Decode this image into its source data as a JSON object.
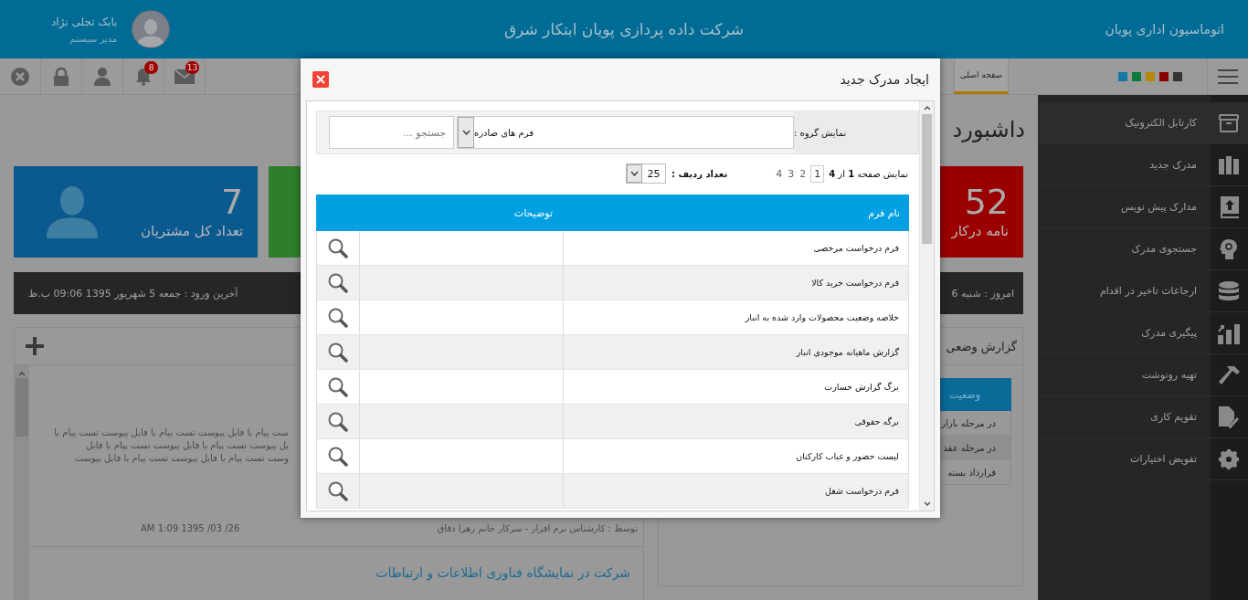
{
  "header": {
    "app_name": "اتوماسیون اداری پویان",
    "company": "شرکت داده پردازی پویان ابتکار شرق",
    "user": {
      "name": "بابک تجلی نژاد",
      "role": "مدیر سیستم"
    }
  },
  "toolbar": {
    "icons": [
      {
        "kind": "mail",
        "badge": "13"
      },
      {
        "kind": "bell",
        "badge": "8"
      },
      {
        "kind": "user"
      },
      {
        "kind": "lock"
      },
      {
        "kind": "close"
      }
    ],
    "tabs": [
      {
        "label": "صفحه اصلی",
        "selected": true
      }
    ],
    "swatches": [
      {
        "color": "#1379a5"
      },
      {
        "color": "#0d7a3d"
      },
      {
        "color": "#b58a0a"
      },
      {
        "color": "#8b0000"
      },
      {
        "color": "#333333"
      }
    ]
  },
  "sidebar": {
    "items": [
      {
        "label": "کارتابل الکترونیک",
        "kind": "archive",
        "selected": true
      },
      {
        "label": "مدرک جدید",
        "kind": "books",
        "selected": false
      },
      {
        "label": "مدارک پیش نویس",
        "kind": "upload-book",
        "selected": false
      },
      {
        "label": "جستجوی مدرک",
        "kind": "head",
        "selected": false
      },
      {
        "label": "ارجاعات تاخیر در اقدام",
        "kind": "database",
        "selected": false
      },
      {
        "label": "پیگیری مدرک",
        "kind": "chart",
        "selected": false
      },
      {
        "label": "تهیه رونوشت",
        "kind": "hammer",
        "selected": false
      },
      {
        "label": "تقویم کاری",
        "kind": "document",
        "selected": false
      },
      {
        "label": "تفویض اختیارات",
        "kind": "gear",
        "selected": false
      }
    ]
  },
  "dashboard": {
    "title": "داشبورد",
    "cards": [
      {
        "kind": "plain",
        "value": "52",
        "label": "نامه درکار",
        "color": "#9a0000"
      },
      {
        "kind": "plain",
        "color": "#2f7f2a"
      },
      {
        "kind": "person",
        "value": "7",
        "label": "تعداد کل مشتریان",
        "color": "#0a5a8f"
      }
    ],
    "last_login": "آخرین ورود : جمعه 5 شهریور 1395 09:06 ب.ظ",
    "today": "امروز : شنبه 6"
  },
  "messages": {
    "lines": [
      "ست پیام با فایل پیوست تست پیام با فایل پیوست تست پیام با",
      "یل پیوست تست پیام با فایل پیوست تست پیام با فایل",
      "وست تست پیام با فایل پیوست تست پیام با فایل پیوست"
    ],
    "date": "AM 1:09 1395 /03 /26",
    "author": "توسط : کارشناس نرم افزار - سرکار خانم زهرا دقاق",
    "next_title": "شرکت در نمایشگاه فناوری اطلاعات و ارتباطات"
  },
  "report": {
    "title": "گزارش وضعی",
    "column": "وضعیت",
    "rows": [
      "در مرحله بازار",
      "در مرحله عقد",
      "قرارداد بسته"
    ]
  },
  "modal": {
    "title": "ایجاد مدرک جدید",
    "group_label": "نمایش گروه :",
    "group_value": "فرم های صادره",
    "search_placeholder": "جستجو ...",
    "page_info": "نمایش صفحه **1** از **4**",
    "pages": [
      {
        "label": "1",
        "selected": true
      },
      {
        "label": "2",
        "selected": false
      },
      {
        "label": "3",
        "selected": false
      },
      {
        "label": "4",
        "selected": false
      }
    ],
    "rows_label": "تعداد ردیف :",
    "rows_value": "25",
    "columns": [
      "نام فرم",
      "توضیحات"
    ],
    "rows": [
      {
        "name": "فرم درخواست مرخصی"
      },
      {
        "name": "فرم درخواست خرید کالا"
      },
      {
        "name": "خلاصه وضعیت محصولات وارد شده به انبار"
      },
      {
        "name": "گزارش ماهیانه موجودی انبار"
      },
      {
        "name": "برگ گزارش خسارت"
      },
      {
        "name": "برگه حقوقی"
      },
      {
        "name": "لیست حضور و غیاب کارکنان"
      },
      {
        "name": "فرم درخواست شغل"
      }
    ]
  }
}
